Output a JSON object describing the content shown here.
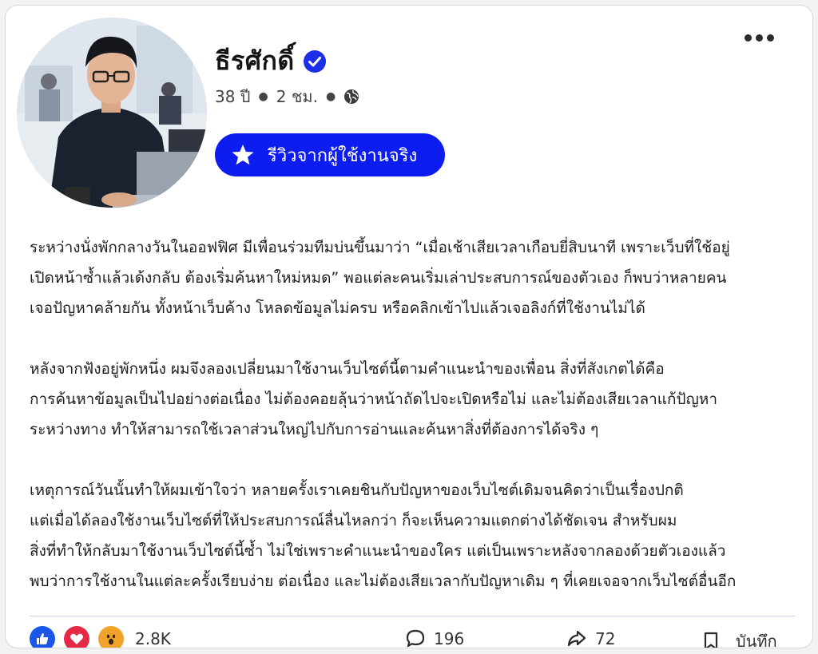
{
  "post": {
    "author_name": "ธีรศักดิ์",
    "age": "38 ปี",
    "time_ago": "2 ชม.",
    "review_badge_label": "รีวิวจากผู้ใช้งานจริง",
    "paragraphs": [
      [
        "ระหว่างนั่งพักกลางวันในออฟฟิศ มีเพื่อนร่วมทีมบ่นขึ้นมาว่า “เมื่อเช้าเสียเวลาเกือบยี่สิบนาที เพราะเว็บที่ใช้อยู่",
        "เปิดหน้าซ้ำแล้วเด้งกลับ ต้องเริ่มค้นหาใหม่หมด” พอแต่ละคนเริ่มเล่าประสบการณ์ของตัวเอง ก็พบว่าหลายคน",
        "เจอปัญหาคล้ายกัน ทั้งหน้าเว็บค้าง โหลดข้อมูลไม่ครบ หรือคลิกเข้าไปแล้วเจอลิงก์ที่ใช้งานไม่ได้"
      ],
      [
        "หลังจากฟังอยู่พักหนึ่ง ผมจึงลองเปลี่ยนมาใช้งานเว็บไซต์นี้ตามคำแนะนำของเพื่อน สิ่งที่สังเกตได้คือ",
        "การค้นหาข้อมูลเป็นไปอย่างต่อเนื่อง ไม่ต้องคอยลุ้นว่าหน้าถัดไปจะเปิดหรือไม่ และไม่ต้องเสียเวลาแก้ปัญหา",
        "ระหว่างทาง ทำให้สามารถใช้เวลาส่วนใหญ่ไปกับการอ่านและค้นหาสิ่งที่ต้องการได้จริง ๆ"
      ],
      [
        "เหตุการณ์วันนั้นทำให้ผมเข้าใจว่า หลายครั้งเราเคยชินกับปัญหาของเว็บไซต์เดิมจนคิดว่าเป็นเรื่องปกติ",
        "แต่เมื่อได้ลองใช้งานเว็บไซต์ที่ให้ประสบการณ์ลื่นไหลกว่า ก็จะเห็นความแตกต่างได้ชัดเจน สำหรับผม",
        "สิ่งที่ทำให้กลับมาใช้งานเว็บไซต์นี้ซ้ำ ไม่ใช่เพราะคำแนะนำของใคร แต่เป็นเพราะหลังจากลองด้วยตัวเองแล้ว",
        "พบว่าการใช้งานในแต่ละครั้งเรียบง่าย ต่อเนื่อง และไม่ต้องเสียเวลากับปัญหาเดิม ๆ ที่เคยเจอจากเว็บไซต์อื่นอีก"
      ]
    ]
  },
  "footer": {
    "reaction_count": "2.8K",
    "comment_count": "196",
    "share_count": "72",
    "save_label": "บันทึก"
  },
  "colors": {
    "badge_blue": "#0d1cef",
    "verified_blue": "#1b2fe6",
    "like_blue": "#1a56e8",
    "love_red": "#e62a46",
    "wow_orange": "#f0a22b"
  },
  "icons": [
    "verified-icon",
    "globe-icon",
    "more-icon",
    "star-icon",
    "like-icon",
    "love-icon",
    "wow-icon",
    "comment-icon",
    "share-icon",
    "bookmark-icon"
  ]
}
